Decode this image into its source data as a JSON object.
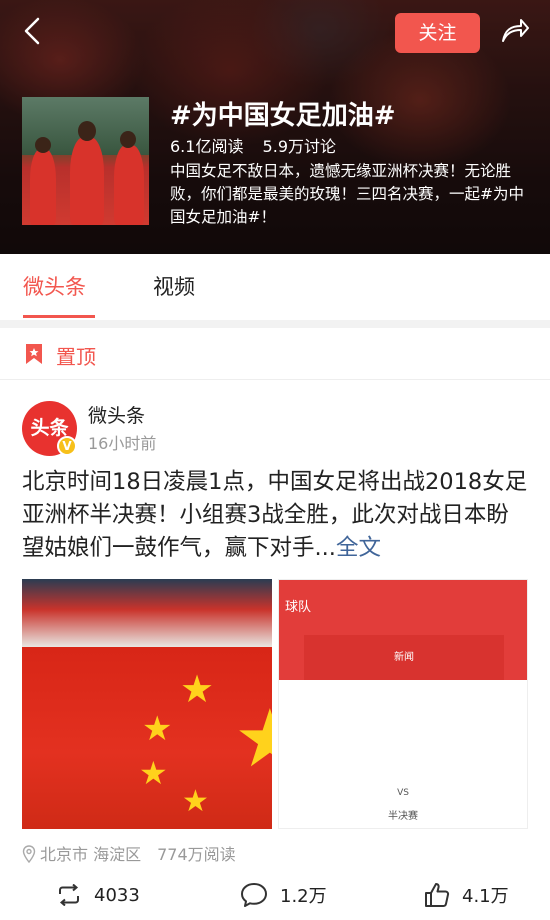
{
  "header": {
    "follow_label": "关注",
    "topic_title": "#为中国女足加油#",
    "reads": "6.1亿阅读",
    "discussions": "5.9万讨论",
    "description": "中国女足不敌日本，遗憾无缘亚洲杯决赛！无论胜败，你们都是最美的玫瑰！三四名决赛，一起#为中国女足加油#！",
    "icons": [
      "back-icon",
      "share-icon"
    ]
  },
  "tabs": [
    {
      "label": "微头条",
      "active": true
    },
    {
      "label": "视频",
      "active": false
    }
  ],
  "pinned": {
    "label": "置顶",
    "icon": "pin-icon"
  },
  "post": {
    "avatar_text": "头条",
    "verified_mark": "V",
    "author": "微头条",
    "time": "16小时前",
    "text": "北京时间18日凌晨1点，中国女足将出战2018女足亚洲杯半决赛！小组赛3战全胜，此次对战日本盼望姑娘们一鼓作气，赢下对手...",
    "more_label": "全文",
    "image_right": {
      "band_title": "球队",
      "button_label": "新闻",
      "vs_label": "VS",
      "stage_label": "半决赛"
    },
    "location": "北京市 海淀区",
    "reads": "774万阅读",
    "reposts": "4033",
    "comments": "1.2万",
    "likes": "4.1万"
  },
  "colors": {
    "accent": "#f2564e",
    "link": "#406599",
    "muted": "#999999"
  }
}
